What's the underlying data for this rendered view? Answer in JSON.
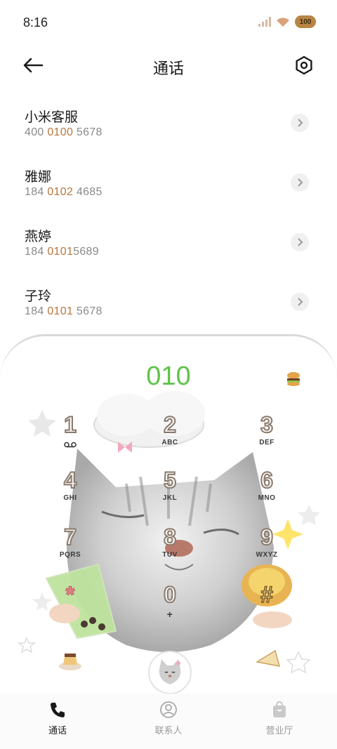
{
  "status_bar": {
    "time": "8:16",
    "battery": "100"
  },
  "header": {
    "title": "通话"
  },
  "contacts": [
    {
      "name": "小米客服",
      "number_parts": [
        "400 ",
        "0",
        "100",
        " 5678"
      ]
    },
    {
      "name": "雅娜",
      "number_parts": [
        "184 ",
        "0102",
        "",
        " 4685"
      ]
    },
    {
      "name": "燕婷",
      "number_parts": [
        "184 ",
        "0101",
        "",
        "5689"
      ]
    },
    {
      "name": "子玲",
      "number_parts": [
        "184 ",
        "0101",
        "",
        " 5678"
      ]
    }
  ],
  "dialpad": {
    "dialed": "010",
    "keys": [
      {
        "digit": "1",
        "letters": ""
      },
      {
        "digit": "2",
        "letters": "ABC"
      },
      {
        "digit": "3",
        "letters": "DEF"
      },
      {
        "digit": "4",
        "letters": "GHI"
      },
      {
        "digit": "5",
        "letters": "JKL"
      },
      {
        "digit": "6",
        "letters": "MNO"
      },
      {
        "digit": "7",
        "letters": "PQRS"
      },
      {
        "digit": "8",
        "letters": "TUV"
      },
      {
        "digit": "9",
        "letters": "WXYZ"
      },
      {
        "digit": "*",
        "letters": ""
      },
      {
        "digit": "0",
        "letters": "+"
      },
      {
        "digit": "#",
        "letters": ""
      }
    ]
  },
  "tabs": [
    {
      "label": "通话",
      "icon": "phone-icon",
      "active": true
    },
    {
      "label": "联系人",
      "icon": "person-icon",
      "active": false
    },
    {
      "label": "营业厅",
      "icon": "bag-icon",
      "active": false
    }
  ],
  "colors": {
    "accent_number": "#5fc34a",
    "highlight": "#b8773c",
    "tab_active": "#1a1a1a",
    "tab_inactive": "#9a9a9a"
  }
}
